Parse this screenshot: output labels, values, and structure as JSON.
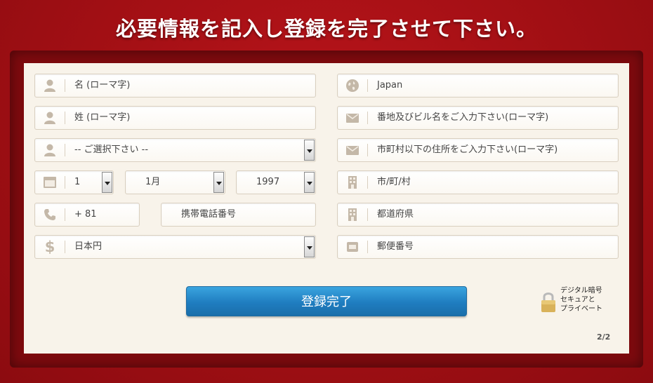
{
  "page": {
    "title": "必要情報を記入し登録を完了させて下さい。"
  },
  "form": {
    "left": {
      "first_name": {
        "placeholder": "名 (ローマ字)",
        "icon": "person-icon"
      },
      "last_name": {
        "placeholder": "姓 (ローマ字)",
        "icon": "person-icon"
      },
      "select": {
        "value": "-- ご選択下さい --",
        "icon": "person-icon"
      },
      "birth_day": {
        "value": "1",
        "icon": "calendar-icon"
      },
      "birth_month": {
        "value": "1月"
      },
      "birth_year": {
        "value": "1997"
      },
      "phone_code": {
        "value": "+ 81",
        "icon": "phone-icon"
      },
      "phone": {
        "placeholder": "携帯電話番号"
      },
      "currency": {
        "value": "日本円",
        "icon": "dollar-icon"
      }
    },
    "right": {
      "country": {
        "value": "Japan",
        "icon": "globe-icon"
      },
      "address1": {
        "placeholder": "番地及びビル名をご入力下さい(ローマ字)",
        "icon": "envelope-icon"
      },
      "address2": {
        "placeholder": "市町村以下の住所をご入力下さい(ローマ字)",
        "icon": "envelope-icon"
      },
      "city": {
        "placeholder": "市/町/村",
        "icon": "building-icon"
      },
      "prefecture": {
        "placeholder": "都道府県",
        "icon": "building-icon"
      },
      "postal": {
        "placeholder": "郵便番号",
        "icon": "mailbox-icon"
      }
    },
    "submit_label": "登録完了",
    "security": {
      "line1": "デジタル暗号",
      "line2": "セキュアと",
      "line3": "プライベート",
      "icon": "padlock-icon"
    },
    "pager": "2/2"
  },
  "colors": {
    "background": "#a10f14",
    "panel": "#f8f3ea",
    "button": "#1f7dc0"
  }
}
